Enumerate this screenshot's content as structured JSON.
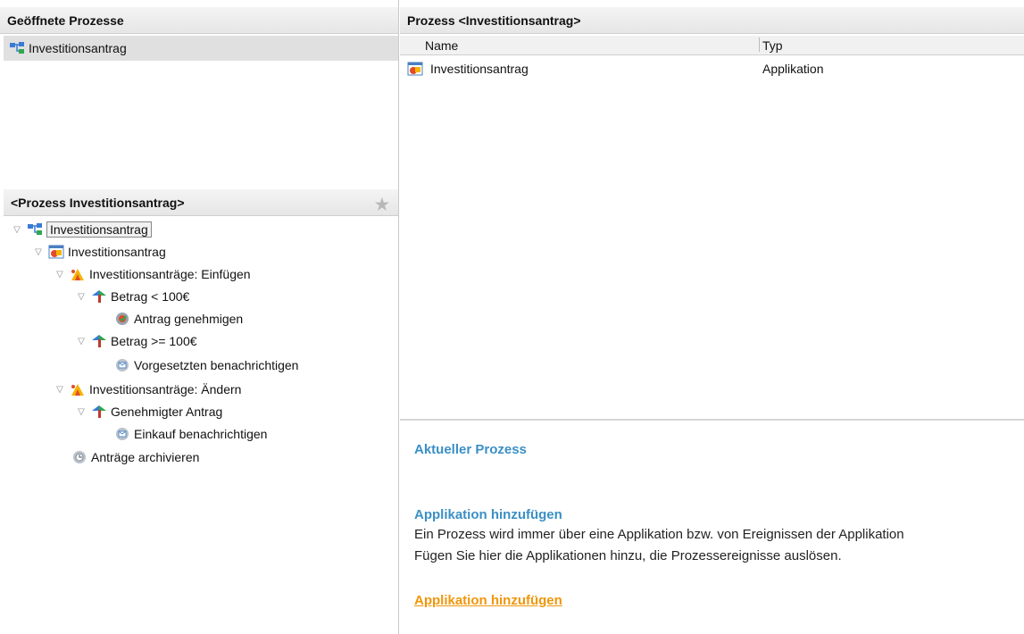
{
  "open_processes": {
    "title": "Geöffnete Prozesse",
    "items": [
      {
        "label": "Investitionsantrag"
      }
    ]
  },
  "tree_panel": {
    "title": "<Prozess Investitionsantrag>",
    "nodes": [
      {
        "label": "Investitionsantrag",
        "icon": "process-icon"
      },
      {
        "label": "Investitionsantrag",
        "icon": "application-icon"
      },
      {
        "label": "Investitionsanträge: Einfügen",
        "icon": "event-icon"
      },
      {
        "label": "Betrag < 100€",
        "icon": "condition-icon"
      },
      {
        "label": "Antrag genehmigen",
        "icon": "action-icon"
      },
      {
        "label": "Betrag >= 100€",
        "icon": "condition-icon"
      },
      {
        "label": "Vorgesetzten benachrichtigen",
        "icon": "notify-icon"
      },
      {
        "label": "Investitionsanträge: Ändern",
        "icon": "event-icon"
      },
      {
        "label": "Genehmigter Antrag",
        "icon": "condition-icon"
      },
      {
        "label": "Einkauf benachrichtigen",
        "icon": "notify-icon"
      },
      {
        "label": "Anträge archivieren",
        "icon": "archive-icon"
      }
    ]
  },
  "process_panel": {
    "title": "Prozess <Investitionsantrag>",
    "columns": [
      "Name",
      "Typ"
    ],
    "rows": [
      {
        "name": "Investitionsantrag",
        "type": "Applikation"
      }
    ]
  },
  "info": {
    "current_title": "Aktueller Prozess",
    "add_title": "Applikation hinzufügen",
    "line1": "Ein Prozess wird immer über eine Applikation bzw. von Ereignissen der Applikation",
    "line2": "Fügen Sie hier die Applikationen hinzu, die Prozessereignisse auslösen.",
    "link": "Applikation hinzufügen"
  },
  "colors": {
    "accent_blue": "#3b8fc5",
    "link_orange": "#f0960a"
  }
}
